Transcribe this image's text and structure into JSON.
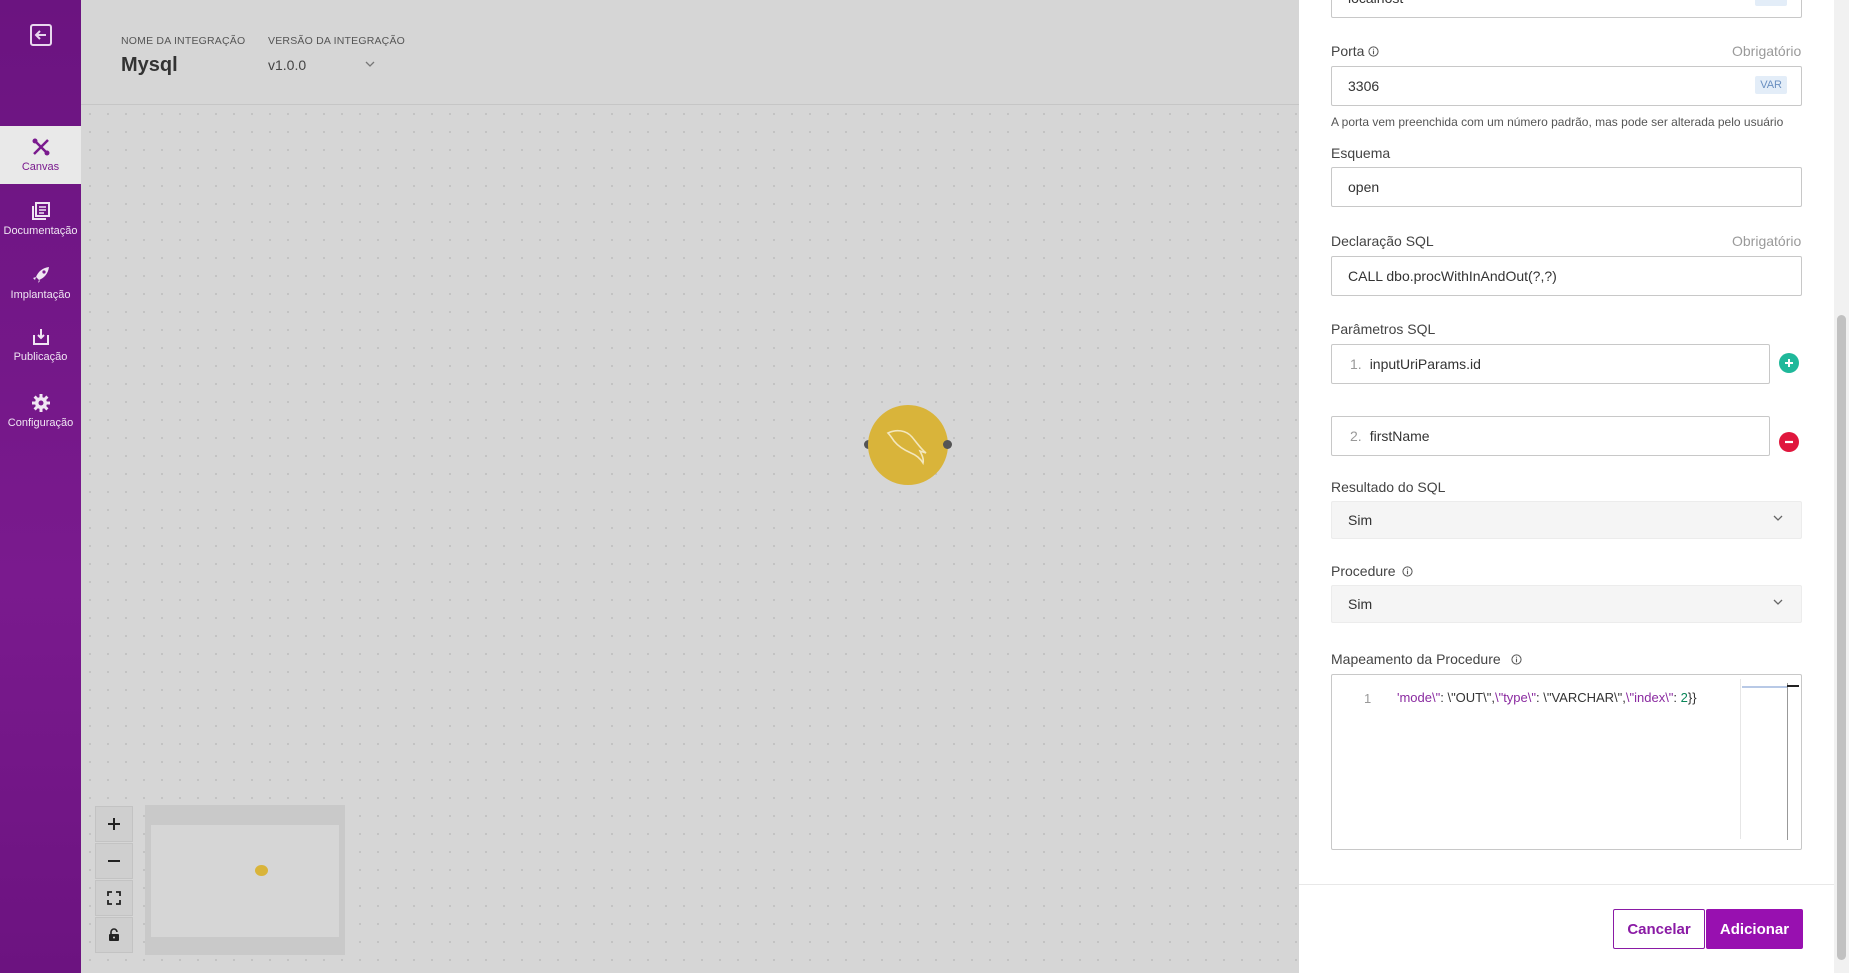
{
  "sidebar": {
    "items": [
      {
        "label": "Canvas",
        "icon": "canvas-tools-icon",
        "active": true
      },
      {
        "label": "Documentação",
        "icon": "documentation-icon",
        "active": false
      },
      {
        "label": "Implantação",
        "icon": "rocket-icon",
        "active": false
      },
      {
        "label": "Publicação",
        "icon": "download-tray-icon",
        "active": false
      },
      {
        "label": "Configuração",
        "icon": "gear-icon",
        "active": false
      }
    ]
  },
  "header": {
    "name_label": "NOME DA INTEGRAÇÃO",
    "name_value": "Mysql",
    "version_label": "VERSÃO DA INTEGRAÇÃO",
    "version_value": "v1.0.0"
  },
  "canvas": {
    "node_icon": "mysql-dolphin-icon",
    "controls": [
      "zoom-in",
      "zoom-out",
      "fit-view",
      "lock"
    ]
  },
  "form": {
    "host_value": "localhost",
    "var_badge": "VAR",
    "port": {
      "label": "Porta",
      "required": "Obrigatório",
      "value": "3306",
      "hint": "A porta vem preenchida com um número padrão, mas pode ser alterada pelo usuário"
    },
    "schema": {
      "label": "Esquema",
      "value": "open"
    },
    "sql": {
      "label": "Declaração SQL",
      "required": "Obrigatório",
      "value": "CALL dbo.procWithInAndOut(?,?)"
    },
    "params": {
      "label": "Parâmetros SQL",
      "items": [
        {
          "index": "1.",
          "value": "inputUriParams.id"
        },
        {
          "index": "2.",
          "value": "firstName"
        }
      ]
    },
    "sql_result": {
      "label": "Resultado do SQL",
      "value": "Sim"
    },
    "procedure": {
      "label": "Procedure",
      "value": "Sim"
    },
    "mapping": {
      "label": "Mapeamento da Procedure",
      "line_number": "1",
      "code_parts": {
        "p1": "'mode\\\"",
        "p2": ": \\\"OUT\\\",",
        "p3": "\\\"type\\\"",
        "p4": ": \\\"VARCHAR\\\",",
        "p5": "\\\"index\\\"",
        "p6": ": ",
        "p7": "2",
        "p8": "}}"
      }
    }
  },
  "footer": {
    "cancel_label": "Cancelar",
    "add_label": "Adicionar"
  },
  "colors": {
    "sidebar": "#7a1a8e",
    "primary": "#9810b0",
    "node": "#d9b43a",
    "add_param": "#1fb89a",
    "remove_param": "#e0173d"
  }
}
